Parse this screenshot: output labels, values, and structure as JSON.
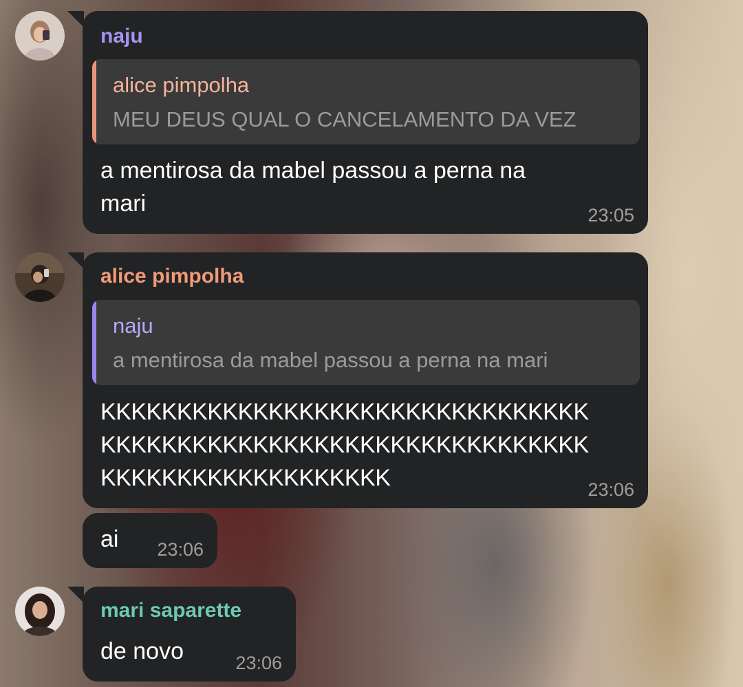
{
  "messages": [
    {
      "sender": "naju",
      "sender_color": "#a694f2",
      "reply": {
        "name": "alice pimpolha",
        "name_color": "#f4b39a",
        "bar_color": "#e8957a",
        "text": "MEU DEUS QUAL O CANCELAMENTO DA VEZ"
      },
      "text_lines": [
        "a mentirosa da mabel passou a perna na",
        "mari"
      ],
      "time": "23:05"
    },
    {
      "sender": "alice pimpolha",
      "sender_color": "#f09a78",
      "reply": {
        "name": "naju",
        "name_color": "#b7aaf5",
        "bar_color": "#9a86ef",
        "text": "a mentirosa da mabel passou a perna na mari"
      },
      "text_lines": [
        "KKKKKKKKKKKKKKKKKKKKKKKKKKKKKKKK",
        "KKKKKKKKKKKKKKKKKKKKKKKKKKKKKKKK",
        "KKKKKKKKKKKKKKKKKKK"
      ],
      "time": "23:06"
    },
    {
      "text": "ai",
      "time": "23:06"
    },
    {
      "sender": "mari saparette",
      "sender_color": "#6cc9b4",
      "text": "de novo",
      "time": "23:06"
    }
  ]
}
